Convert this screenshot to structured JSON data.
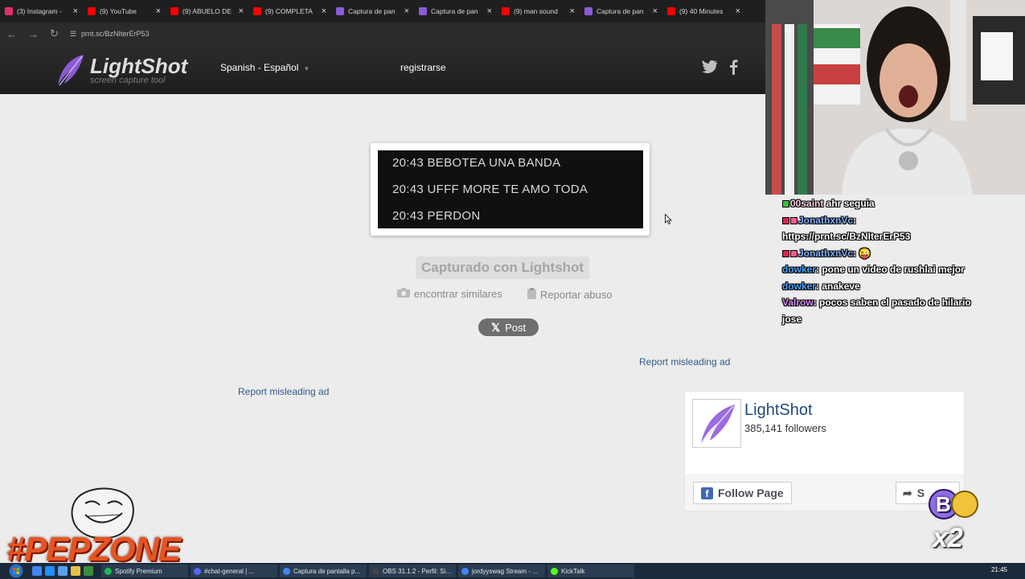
{
  "browser": {
    "tabs": [
      {
        "label": "(3) Instagram -",
        "icon_color": "#e1306c"
      },
      {
        "label": "(9) YouTube",
        "icon_color": "#ff0000"
      },
      {
        "label": "(9) ABUELO DE",
        "icon_color": "#ff0000"
      },
      {
        "label": "(9) COMPLETA",
        "icon_color": "#ff0000"
      },
      {
        "label": "Captura de pan",
        "icon_color": "#8b5bd6"
      },
      {
        "label": "Captura de pan",
        "icon_color": "#8b5bd6"
      },
      {
        "label": "(9) man sound",
        "icon_color": "#ff0000"
      },
      {
        "label": "Captura de pan",
        "icon_color": "#8b5bd6"
      },
      {
        "label": "(9) 40 Minutes",
        "icon_color": "#ff0000"
      }
    ],
    "url": "prnt.sc/BzNIterErP53"
  },
  "header": {
    "logo_name": "LightShot",
    "logo_tagline": "screen capture tool",
    "language": "Spanish - Español",
    "register_label": "registrarse",
    "twitter_icon": "twitter-icon",
    "facebook_icon": "facebook-icon"
  },
  "screenshot": {
    "lines": [
      "20:43 BEBOTEA UNA BANDA",
      "20:43 UFFF MORE TE AMO TODA",
      "20:43 PERDON"
    ]
  },
  "captured_label": "Capturado con Lightshot",
  "actions": {
    "similar_label": "encontrar similares",
    "report_label": "Reportar abuso"
  },
  "tweet_button_label": "Post",
  "ads": {
    "report_misleading_right": "Report misleading ad",
    "report_misleading_left": "Report misleading ad"
  },
  "facebook_widget": {
    "page_name": "LightShot",
    "followers": "385,141 followers",
    "follow_label": "Follow Page",
    "share_label": "S"
  },
  "stream_chat": [
    {
      "user": "00saint",
      "text": " ahr seguia",
      "color": "#ffd1e6"
    },
    {
      "user": "JonathxnVc",
      "text": ":",
      "color": "#7fb2ff"
    },
    {
      "user": "",
      "text": "https://prnt.sc/BzNIterErP53",
      "color": "#ffffff"
    },
    {
      "user": "JonathxnVc",
      "text": ": 😜",
      "color": "#7fb2ff"
    },
    {
      "user": "dowker",
      "text": ": pone un video de rushlai mejor",
      "color": "#4aa3ff"
    },
    {
      "user": "dowker",
      "text": ": anakeve",
      "color": "#4aa3ff"
    },
    {
      "user": "Valrow",
      "text": ": pocos saben el pasado de hilario",
      "color": "#e08cff"
    },
    {
      "user": "",
      "text": "jose",
      "color": "#ffffff"
    }
  ],
  "overlay": {
    "tag": "#PEPZONE",
    "bits": "💰",
    "multiplier": "x2"
  },
  "taskbar": {
    "tasks": [
      {
        "label": "Spotify Premium",
        "color": "#1db954"
      },
      {
        "label": "#chat-general | ...",
        "color": "#5865f2"
      },
      {
        "label": "Captura de pantalla p...",
        "color": "#4285f4"
      },
      {
        "label": "OBS 31.1.2 - Perfil: Si...",
        "color": "#444444"
      },
      {
        "label": "jordyyswag Stream - ...",
        "color": "#4285f4"
      },
      {
        "label": "KickTalk",
        "color": "#53fc18"
      }
    ],
    "time": "21:45"
  }
}
